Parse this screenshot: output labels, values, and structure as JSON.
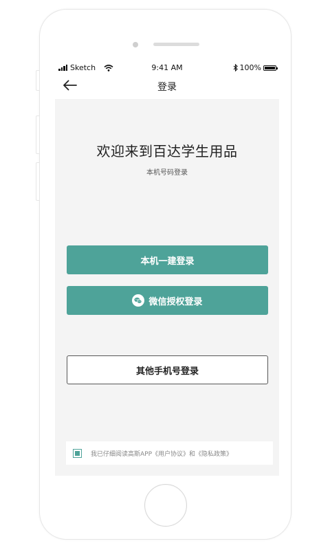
{
  "status_bar": {
    "carrier": "Sketch",
    "time": "9:41 AM",
    "battery": "100%"
  },
  "nav": {
    "title": "登录",
    "back_icon": "arrow-left-icon"
  },
  "welcome": {
    "title": "欢迎来到百达学生用品",
    "subtitle": "本机号码登录"
  },
  "buttons": {
    "one_click_login": "本机一建登录",
    "wechat_login": "微信授权登录",
    "other_phone_login": "其他手机号登录"
  },
  "agreement": {
    "checked": true,
    "text": "我已仔细阅读高斯APP《用户协议》和《隐私政策》"
  },
  "colors": {
    "accent": "#4ea399",
    "content_background": "#f4f4f4"
  }
}
